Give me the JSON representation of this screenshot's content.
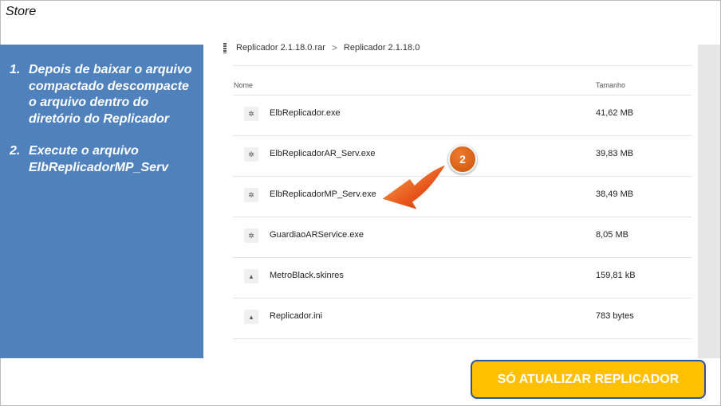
{
  "store": {
    "title": "Store"
  },
  "instructions": [
    {
      "num": "1.",
      "text": "Depois de baixar o arquivo compactado descompacte o arquivo dentro do diretório do Replicador"
    },
    {
      "num": "2.",
      "text": "Execute o arquivo ElbReplicadorMP_Serv"
    }
  ],
  "breadcrumb": {
    "archive": "Replicador 2.1.18.0.rar",
    "separator": ">",
    "folder": "Replicador 2.1.18.0"
  },
  "table": {
    "col_name": "Nome",
    "col_size": "Tamanho",
    "rows": [
      {
        "icon": "gear-icon",
        "glyph": "✲",
        "name": "ElbReplicador.exe",
        "size": "41,62 MB"
      },
      {
        "icon": "gear-icon",
        "glyph": "✲",
        "name": "ElbReplicadorAR_Serv.exe",
        "size": "39,83 MB"
      },
      {
        "icon": "gear-icon",
        "glyph": "✲",
        "name": "ElbReplicadorMP_Serv.exe",
        "size": "38,49 MB"
      },
      {
        "icon": "gear-icon",
        "glyph": "✲",
        "name": "GuardiaoARService.exe",
        "size": "8,05 MB"
      },
      {
        "icon": "file-icon",
        "glyph": "▴",
        "name": "MetroBlack.skinres",
        "size": "159,81 kB"
      },
      {
        "icon": "file-icon",
        "glyph": "▴",
        "name": "Replicador.ini",
        "size": "783 bytes"
      }
    ]
  },
  "callout": {
    "number": "2"
  },
  "cta": {
    "label": "SÓ ATUALIZAR REPLICADOR"
  },
  "colors": {
    "panel": "#4f81bd",
    "badge": "#e0651a",
    "button": "#ffc000",
    "button_border": "#2f5597"
  }
}
